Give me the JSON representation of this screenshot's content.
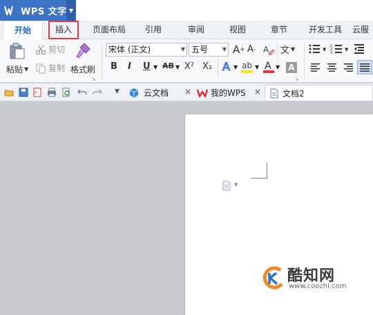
{
  "app": {
    "name": "WPS 文字",
    "accent": "#3c73c4"
  },
  "tabs": [
    {
      "label": "开始",
      "active": true
    },
    {
      "label": "插入",
      "highlighted": true
    },
    {
      "label": "页面布局"
    },
    {
      "label": "引用"
    },
    {
      "label": "审阅"
    },
    {
      "label": "视图"
    },
    {
      "label": "章节"
    },
    {
      "label": "开发工具"
    },
    {
      "label": "云服"
    }
  ],
  "ribbon": {
    "paste_label": "粘贴",
    "cut_label": "剪切",
    "copy_label": "复制",
    "format_painter_label": "格式刷",
    "font_name": "宋体 (正文)",
    "font_size": "五号",
    "superscript_label": "X²",
    "subscript_label": "X₂"
  },
  "quickbar": {
    "doc_tabs": [
      {
        "label": "云文档"
      },
      {
        "label": "我的WPS"
      },
      {
        "label": "文档2",
        "active": true
      }
    ]
  },
  "watermark": {
    "title": "酷知网",
    "url": "www.coozhi.com"
  },
  "colors": {
    "highlight_border": "#e8373d",
    "font_color": "#e8373d",
    "highlighter": "#f5e31a"
  }
}
